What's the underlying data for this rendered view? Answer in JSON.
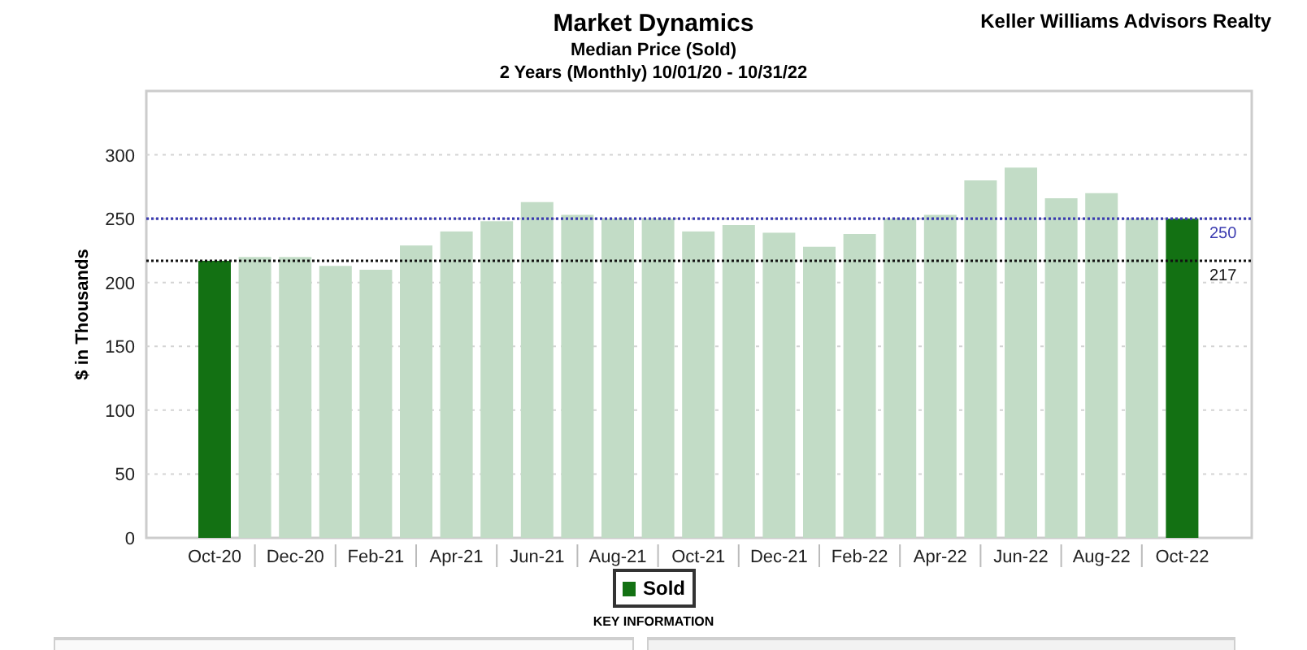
{
  "header": {
    "title": "Market Dynamics",
    "subtitle": "Median Price (Sold)",
    "period": "2 Years (Monthly) 10/01/20 - 10/31/22",
    "company": "Keller Williams Advisors Realty"
  },
  "chart": {
    "chart_data": {
      "type": "bar",
      "ylabel": "$ in Thousands",
      "categories": [
        "Oct-20",
        null,
        "Dec-20",
        null,
        "Feb-21",
        null,
        "Apr-21",
        null,
        "Jun-21",
        null,
        "Aug-21",
        null,
        "Oct-21",
        null,
        "Dec-21",
        null,
        "Feb-22",
        null,
        "Apr-22",
        null,
        "Jun-22",
        null,
        "Aug-22",
        null,
        "Oct-22"
      ],
      "grid": true,
      "series": [
        {
          "name": "Sold",
          "color": "#137113",
          "values": [
            217,
            null,
            null,
            null,
            null,
            null,
            null,
            null,
            null,
            null,
            null,
            null,
            null,
            null,
            null,
            null,
            null,
            null,
            null,
            null,
            null,
            null,
            null,
            null,
            250
          ]
        },
        {
          "color": "#c2dcc6",
          "values": [
            null,
            220,
            220,
            213,
            210,
            229,
            240,
            248,
            263,
            253,
            250,
            250,
            240,
            245,
            239,
            228,
            238,
            250,
            253,
            280,
            290,
            266,
            270,
            250,
            null
          ]
        }
      ],
      "stacked": true,
      "ylim": [
        0,
        350
      ],
      "yticks": [
        0,
        50,
        100,
        150,
        200,
        250,
        300
      ],
      "ref_lines": [
        {
          "axis": "y",
          "value": 250,
          "label": "250",
          "color": "#3b3bb0"
        },
        {
          "axis": "y",
          "value": 217,
          "label": "217",
          "color": "#111111"
        }
      ]
    }
  },
  "legend": {
    "caption": "KEY INFORMATION"
  }
}
